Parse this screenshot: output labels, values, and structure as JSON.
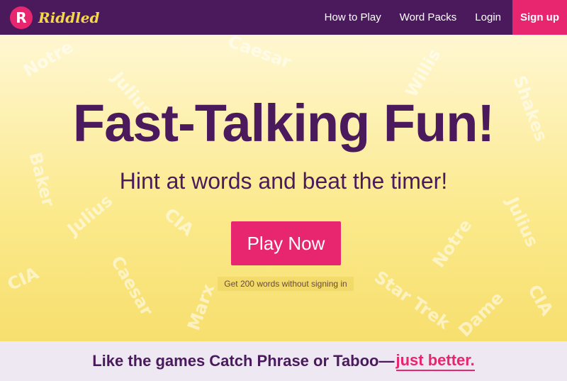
{
  "brand": {
    "logo_letter": "R",
    "name": "Riddled"
  },
  "nav": {
    "links": [
      "How to Play",
      "Word Packs",
      "Login"
    ],
    "signup": "Sign up"
  },
  "hero": {
    "headline": "Fast-Talking Fun!",
    "subline": "Hint at words and beat the timer!",
    "play_button": "Play Now",
    "play_note": "Get 200 words without signing in"
  },
  "tagline": {
    "prefix": "Like the games Catch Phrase or Taboo—",
    "accent": "just better."
  },
  "colors": {
    "nav_bg": "#4a1a5c",
    "accent_pink": "#e8256f",
    "brand_yellow": "#f5d84a",
    "hero_bg": "#fbe98a",
    "tagline_bg": "#ede8f2"
  }
}
